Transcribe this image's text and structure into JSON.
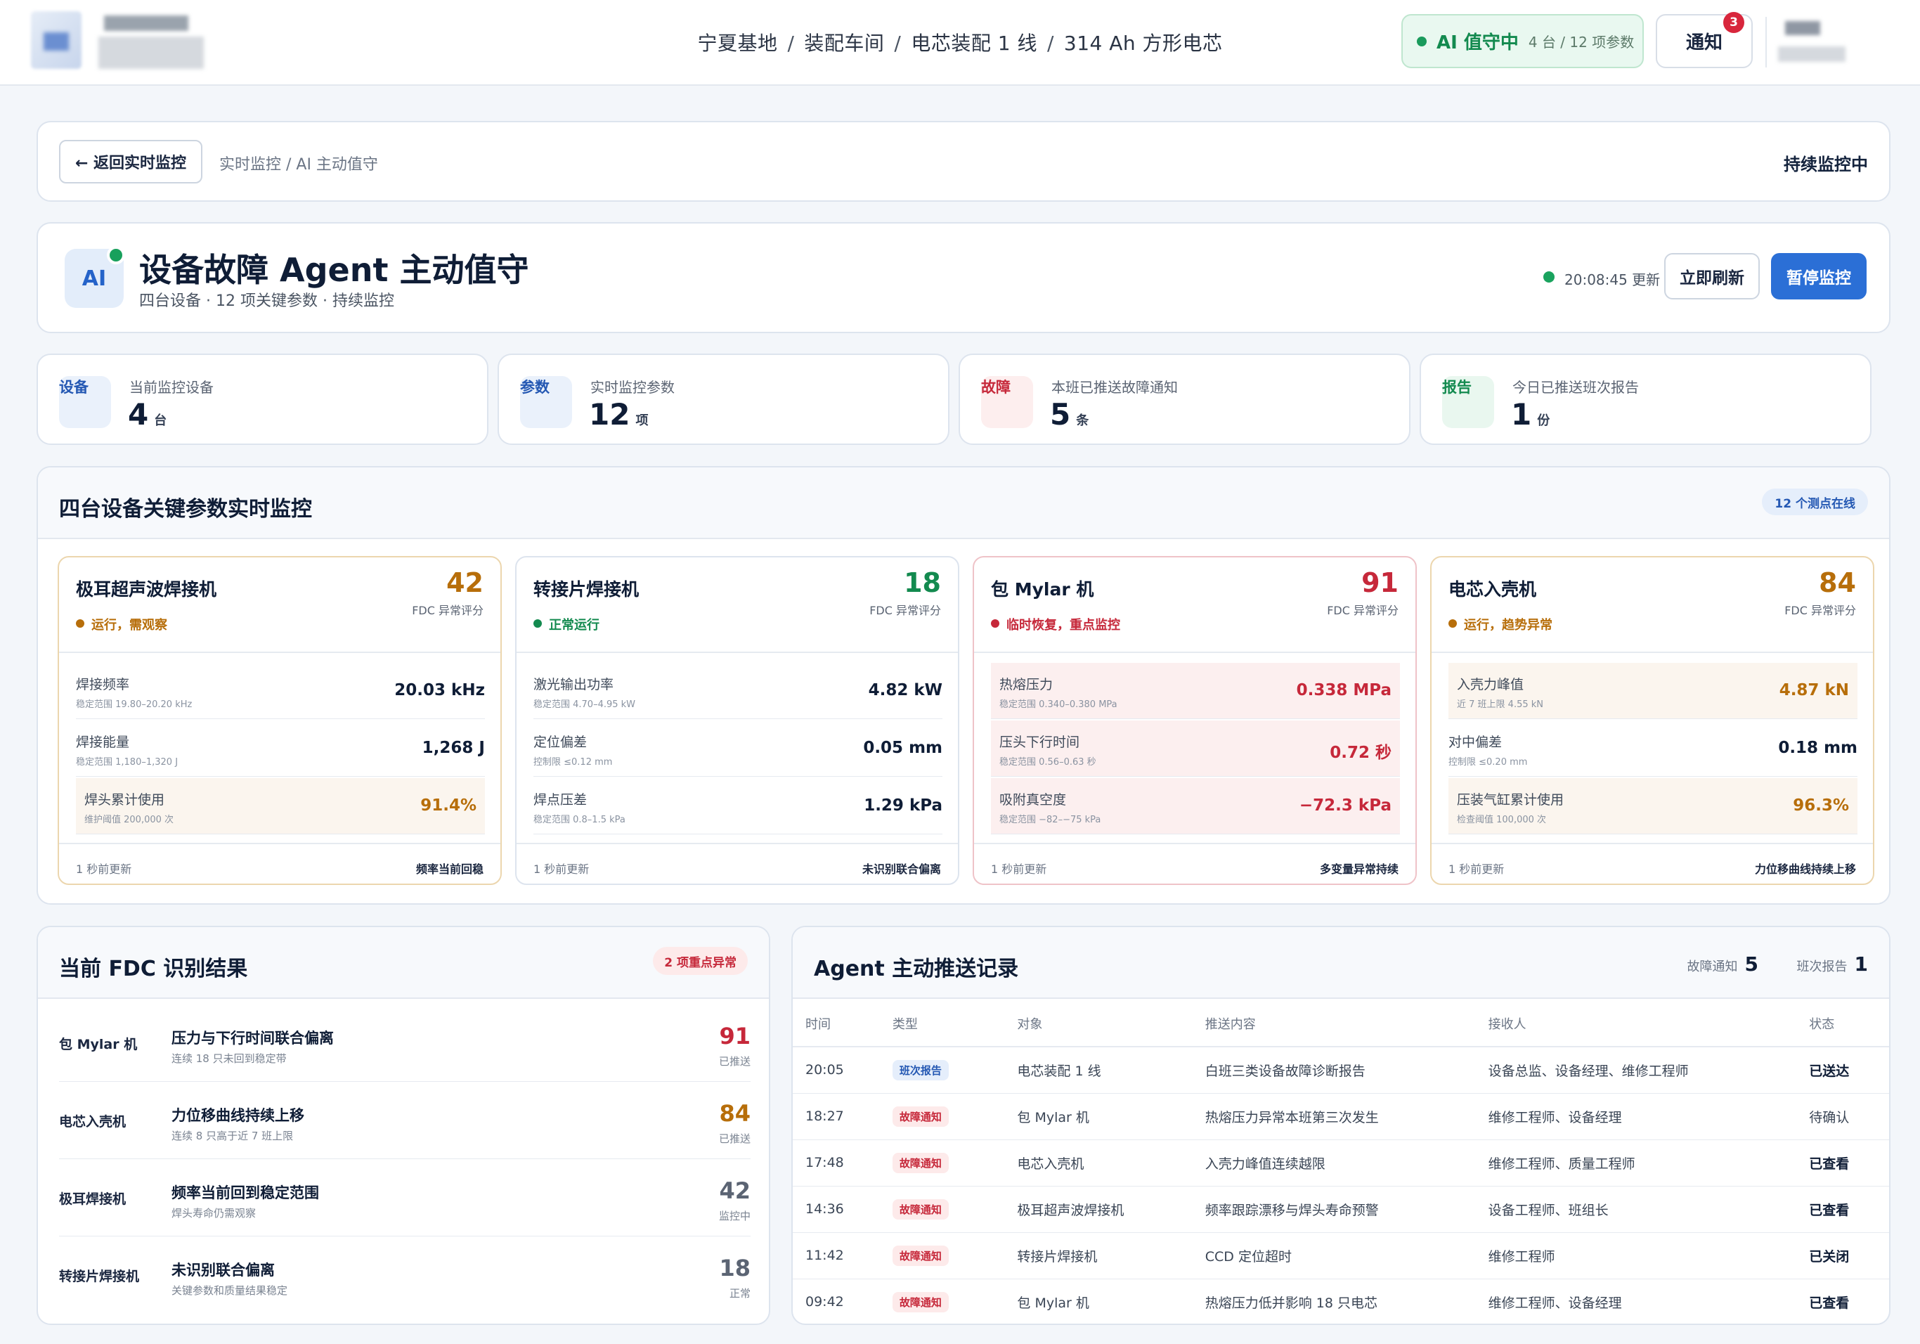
{
  "header": {
    "breadcrumb": [
      "宁夏基地",
      "装配车间",
      "电芯装配 1 线",
      "314 Ah 方形电芯"
    ],
    "breadcrumb_sep": "/",
    "ai_status": "AI 值守中",
    "ai_scope": "4 台 / 12 项参数",
    "notify_label": "通知",
    "notify_count": "3"
  },
  "backbar": {
    "back_label": "← 返回实时监控",
    "path": "实时监控 / AI 主动值守",
    "status": "持续监控中"
  },
  "hero": {
    "avatar": "AI",
    "title": "设备故障 Agent 主动值守",
    "subtitle": "四台设备 · 12 项关键参数 · 持续监控",
    "updated": "20:08:45 更新",
    "refresh_label": "立即刷新",
    "pause_label": "暂停监控"
  },
  "kpis": [
    {
      "tag": "设备",
      "label": "当前监控设备",
      "value": "4",
      "unit": "台",
      "color": "#2458b3",
      "bg": "#eaf1fb"
    },
    {
      "tag": "参数",
      "label": "实时监控参数",
      "value": "12",
      "unit": "项",
      "color": "#2458b3",
      "bg": "#eaf1fb"
    },
    {
      "tag": "故障",
      "label": "本班已推送故障通知",
      "value": "5",
      "unit": "条",
      "color": "#c6283a",
      "bg": "#fdeeee"
    },
    {
      "tag": "报告",
      "label": "今日已推送班次报告",
      "value": "1",
      "unit": "份",
      "color": "#138a4f",
      "bg": "#e9f7ef"
    }
  ],
  "devices_panel": {
    "title": "四台设备关键参数实时监控",
    "badge": "12 个测点在线",
    "score_label": "FDC 异常评分",
    "devices": [
      {
        "name": "极耳超声波焊接机",
        "score": "42",
        "status": "运行，需观察",
        "accent": "#b76e0a",
        "border": "#ecd6ae",
        "rows": [
          {
            "name": "焊接频率",
            "range": "稳定范围 19.80–20.20 kHz",
            "value": "20.03 kHz"
          },
          {
            "name": "焊接能量",
            "range": "稳定范围 1,180–1,320 J",
            "value": "1,268 J"
          },
          {
            "name": "焊头累计使用",
            "range": "维护阈值 200,000 次",
            "value": "91.4%"
          }
        ],
        "footer_left": "1 秒前更新",
        "footer_right": "频率当前回稳"
      },
      {
        "name": "转接片焊接机",
        "score": "18",
        "status": "正常运行",
        "accent": "#138a4f",
        "border": "#dde4ee",
        "rows": [
          {
            "name": "激光输出功率",
            "range": "稳定范围 4.70–4.95 kW",
            "value": "4.82 kW"
          },
          {
            "name": "定位偏差",
            "range": "控制限 ≤0.12 mm",
            "value": "0.05 mm"
          },
          {
            "name": "焊点压差",
            "range": "稳定范围 0.8–1.5 kPa",
            "value": "1.29 kPa"
          }
        ],
        "footer_left": "1 秒前更新",
        "footer_right": "未识别联合偏离"
      },
      {
        "name": "包 Mylar 机",
        "score": "91",
        "status": "临时恢复，重点监控",
        "accent": "#c6283a",
        "border": "#efc3c8",
        "rows": [
          {
            "name": "热熔压力",
            "range": "稳定范围 0.340–0.380 MPa",
            "value": "0.338 MPa"
          },
          {
            "name": "压头下行时间",
            "range": "稳定范围 0.56–0.63 秒",
            "value": "0.72 秒"
          },
          {
            "name": "吸附真空度",
            "range": "稳定范围 −82–−75 kPa",
            "value": "−72.3 kPa"
          }
        ],
        "footer_left": "1 秒前更新",
        "footer_right": "多变量异常持续"
      },
      {
        "name": "电芯入壳机",
        "score": "84",
        "status": "运行，趋势异常",
        "accent": "#b76e0a",
        "border": "#ecd6ae",
        "rows": [
          {
            "name": "入壳力峰值",
            "range": "近 7 班上限 4.55 kN",
            "value": "4.87 kN"
          },
          {
            "name": "对中偏差",
            "range": "控制限 ≤0.20 mm",
            "value": "0.18 mm"
          },
          {
            "name": "压装气缸累计使用",
            "range": "检查阈值 100,000 次",
            "value": "96.3%"
          }
        ],
        "footer_left": "1 秒前更新",
        "footer_right": "力位移曲线持续上移"
      }
    ]
  },
  "fdc": {
    "title": "当前 FDC 识别结果",
    "badge": "2 项重点异常",
    "rows": [
      {
        "device": "包 Mylar 机",
        "title": "压力与下行时间联合偏离",
        "sub": "连续 18 只未回到稳定带",
        "score": "91",
        "status": "已推送",
        "color": "#c6283a"
      },
      {
        "device": "电芯入壳机",
        "title": "力位移曲线持续上移",
        "sub": "连续 8 只高于近 7 班上限",
        "score": "84",
        "status": "已推送",
        "color": "#b76e0a"
      },
      {
        "device": "极耳焊接机",
        "title": "频率当前回到稳定范围",
        "sub": "焊头寿命仍需观察",
        "score": "42",
        "status": "监控中",
        "color": "#5b6473"
      },
      {
        "device": "转接片焊接机",
        "title": "未识别联合偏离",
        "sub": "关键参数和质量结果稳定",
        "score": "18",
        "status": "正常",
        "color": "#5b6473"
      }
    ]
  },
  "push": {
    "title": "Agent 主动推送记录",
    "fault_label": "故障通知",
    "fault_count": "5",
    "report_label": "班次报告",
    "report_count": "1",
    "columns": [
      "时间",
      "类型",
      "对象",
      "推送内容",
      "接收人",
      "状态"
    ],
    "rows": [
      {
        "time": "20:05",
        "type": "班次报告",
        "kind": "blue",
        "target": "电芯装配 1 线",
        "content": "白班三类设备故障诊断报告",
        "recv": "设备总监、设备经理、维修工程师",
        "status": "已送达",
        "bold": true
      },
      {
        "time": "18:27",
        "type": "故障通知",
        "kind": "red",
        "target": "包 Mylar 机",
        "content": "热熔压力异常本班第三次发生",
        "recv": "维修工程师、设备经理",
        "status": "待确认",
        "bold": false
      },
      {
        "time": "17:48",
        "type": "故障通知",
        "kind": "red",
        "target": "电芯入壳机",
        "content": "入壳力峰值连续越限",
        "recv": "维修工程师、质量工程师",
        "status": "已查看",
        "bold": true
      },
      {
        "time": "14:36",
        "type": "故障通知",
        "kind": "red",
        "target": "极耳超声波焊接机",
        "content": "频率跟踪漂移与焊头寿命预警",
        "recv": "设备工程师、班组长",
        "status": "已查看",
        "bold": true
      },
      {
        "time": "11:42",
        "type": "故障通知",
        "kind": "red",
        "target": "转接片焊接机",
        "content": "CCD 定位超时",
        "recv": "维修工程师",
        "status": "已关闭",
        "bold": true
      },
      {
        "time": "09:42",
        "type": "故障通知",
        "kind": "red",
        "target": "包 Mylar 机",
        "content": "热熔压力低并影响 18 只电芯",
        "recv": "维修工程师、设备经理",
        "status": "已查看",
        "bold": true
      }
    ]
  }
}
